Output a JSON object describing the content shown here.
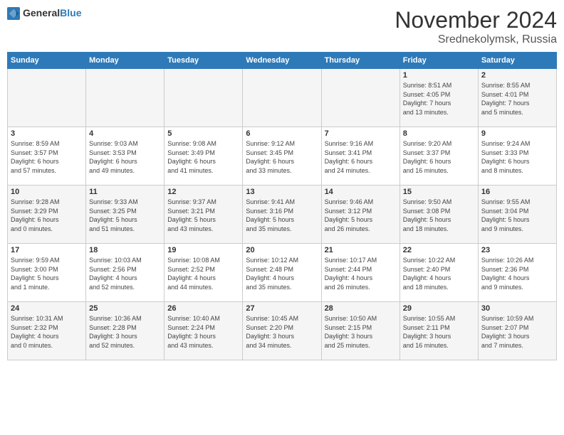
{
  "header": {
    "logo_general": "General",
    "logo_blue": "Blue",
    "month": "November 2024",
    "location": "Srednekolymsk, Russia"
  },
  "weekdays": [
    "Sunday",
    "Monday",
    "Tuesday",
    "Wednesday",
    "Thursday",
    "Friday",
    "Saturday"
  ],
  "weeks": [
    [
      {
        "day": "",
        "info": ""
      },
      {
        "day": "",
        "info": ""
      },
      {
        "day": "",
        "info": ""
      },
      {
        "day": "",
        "info": ""
      },
      {
        "day": "",
        "info": ""
      },
      {
        "day": "1",
        "info": "Sunrise: 8:51 AM\nSunset: 4:05 PM\nDaylight: 7 hours\nand 13 minutes."
      },
      {
        "day": "2",
        "info": "Sunrise: 8:55 AM\nSunset: 4:01 PM\nDaylight: 7 hours\nand 5 minutes."
      }
    ],
    [
      {
        "day": "3",
        "info": "Sunrise: 8:59 AM\nSunset: 3:57 PM\nDaylight: 6 hours\nand 57 minutes."
      },
      {
        "day": "4",
        "info": "Sunrise: 9:03 AM\nSunset: 3:53 PM\nDaylight: 6 hours\nand 49 minutes."
      },
      {
        "day": "5",
        "info": "Sunrise: 9:08 AM\nSunset: 3:49 PM\nDaylight: 6 hours\nand 41 minutes."
      },
      {
        "day": "6",
        "info": "Sunrise: 9:12 AM\nSunset: 3:45 PM\nDaylight: 6 hours\nand 33 minutes."
      },
      {
        "day": "7",
        "info": "Sunrise: 9:16 AM\nSunset: 3:41 PM\nDaylight: 6 hours\nand 24 minutes."
      },
      {
        "day": "8",
        "info": "Sunrise: 9:20 AM\nSunset: 3:37 PM\nDaylight: 6 hours\nand 16 minutes."
      },
      {
        "day": "9",
        "info": "Sunrise: 9:24 AM\nSunset: 3:33 PM\nDaylight: 6 hours\nand 8 minutes."
      }
    ],
    [
      {
        "day": "10",
        "info": "Sunrise: 9:28 AM\nSunset: 3:29 PM\nDaylight: 6 hours\nand 0 minutes."
      },
      {
        "day": "11",
        "info": "Sunrise: 9:33 AM\nSunset: 3:25 PM\nDaylight: 5 hours\nand 51 minutes."
      },
      {
        "day": "12",
        "info": "Sunrise: 9:37 AM\nSunset: 3:21 PM\nDaylight: 5 hours\nand 43 minutes."
      },
      {
        "day": "13",
        "info": "Sunrise: 9:41 AM\nSunset: 3:16 PM\nDaylight: 5 hours\nand 35 minutes."
      },
      {
        "day": "14",
        "info": "Sunrise: 9:46 AM\nSunset: 3:12 PM\nDaylight: 5 hours\nand 26 minutes."
      },
      {
        "day": "15",
        "info": "Sunrise: 9:50 AM\nSunset: 3:08 PM\nDaylight: 5 hours\nand 18 minutes."
      },
      {
        "day": "16",
        "info": "Sunrise: 9:55 AM\nSunset: 3:04 PM\nDaylight: 5 hours\nand 9 minutes."
      }
    ],
    [
      {
        "day": "17",
        "info": "Sunrise: 9:59 AM\nSunset: 3:00 PM\nDaylight: 5 hours\nand 1 minute."
      },
      {
        "day": "18",
        "info": "Sunrise: 10:03 AM\nSunset: 2:56 PM\nDaylight: 4 hours\nand 52 minutes."
      },
      {
        "day": "19",
        "info": "Sunrise: 10:08 AM\nSunset: 2:52 PM\nDaylight: 4 hours\nand 44 minutes."
      },
      {
        "day": "20",
        "info": "Sunrise: 10:12 AM\nSunset: 2:48 PM\nDaylight: 4 hours\nand 35 minutes."
      },
      {
        "day": "21",
        "info": "Sunrise: 10:17 AM\nSunset: 2:44 PM\nDaylight: 4 hours\nand 26 minutes."
      },
      {
        "day": "22",
        "info": "Sunrise: 10:22 AM\nSunset: 2:40 PM\nDaylight: 4 hours\nand 18 minutes."
      },
      {
        "day": "23",
        "info": "Sunrise: 10:26 AM\nSunset: 2:36 PM\nDaylight: 4 hours\nand 9 minutes."
      }
    ],
    [
      {
        "day": "24",
        "info": "Sunrise: 10:31 AM\nSunset: 2:32 PM\nDaylight: 4 hours\nand 0 minutes."
      },
      {
        "day": "25",
        "info": "Sunrise: 10:36 AM\nSunset: 2:28 PM\nDaylight: 3 hours\nand 52 minutes."
      },
      {
        "day": "26",
        "info": "Sunrise: 10:40 AM\nSunset: 2:24 PM\nDaylight: 3 hours\nand 43 minutes."
      },
      {
        "day": "27",
        "info": "Sunrise: 10:45 AM\nSunset: 2:20 PM\nDaylight: 3 hours\nand 34 minutes."
      },
      {
        "day": "28",
        "info": "Sunrise: 10:50 AM\nSunset: 2:15 PM\nDaylight: 3 hours\nand 25 minutes."
      },
      {
        "day": "29",
        "info": "Sunrise: 10:55 AM\nSunset: 2:11 PM\nDaylight: 3 hours\nand 16 minutes."
      },
      {
        "day": "30",
        "info": "Sunrise: 10:59 AM\nSunset: 2:07 PM\nDaylight: 3 hours\nand 7 minutes."
      }
    ]
  ]
}
